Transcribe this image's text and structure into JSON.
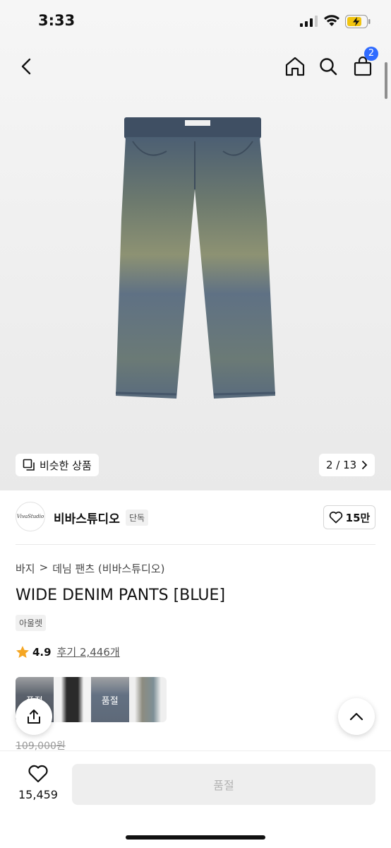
{
  "status_bar": {
    "time": "3:33"
  },
  "nav": {
    "cart_count": "2"
  },
  "hero": {
    "similar_label": "비슷한 상품",
    "image_counter": "2 / 13"
  },
  "store": {
    "logo_text": "VivaStudio",
    "name": "비바스튜디오",
    "exclusive_tag": "단독",
    "likes": "15만"
  },
  "breadcrumb": {
    "level1": "바지",
    "separator": ">",
    "level2": "데님 팬츠 (비바스튜디오)"
  },
  "product": {
    "title": "WIDE DENIM PANTS [BLUE]",
    "outlet_tag": "아울렛",
    "rating": "4.9",
    "reviews": "후기 2,446개",
    "original_price": "109,000원"
  },
  "variants": [
    {
      "sold_out_label": "품절",
      "color": "#36465e"
    },
    {
      "sold_out_label": "",
      "color": "#2a2a2a"
    },
    {
      "sold_out_label": "품절",
      "color": "#4a6890"
    },
    {
      "sold_out_label": "",
      "color": "#8d8c80"
    }
  ],
  "bottom_bar": {
    "wishlist_count": "15,459",
    "primary_button": "품절"
  },
  "colors": {
    "accent_blue": "#2f6bff",
    "star": "#f5a623",
    "denim": "#5e6f80"
  },
  "icons": [
    "back-icon",
    "home-icon",
    "search-icon",
    "bag-icon",
    "similar-icon",
    "chevron-right-icon",
    "heart-icon",
    "star-icon",
    "share-icon",
    "chevron-up-icon"
  ]
}
